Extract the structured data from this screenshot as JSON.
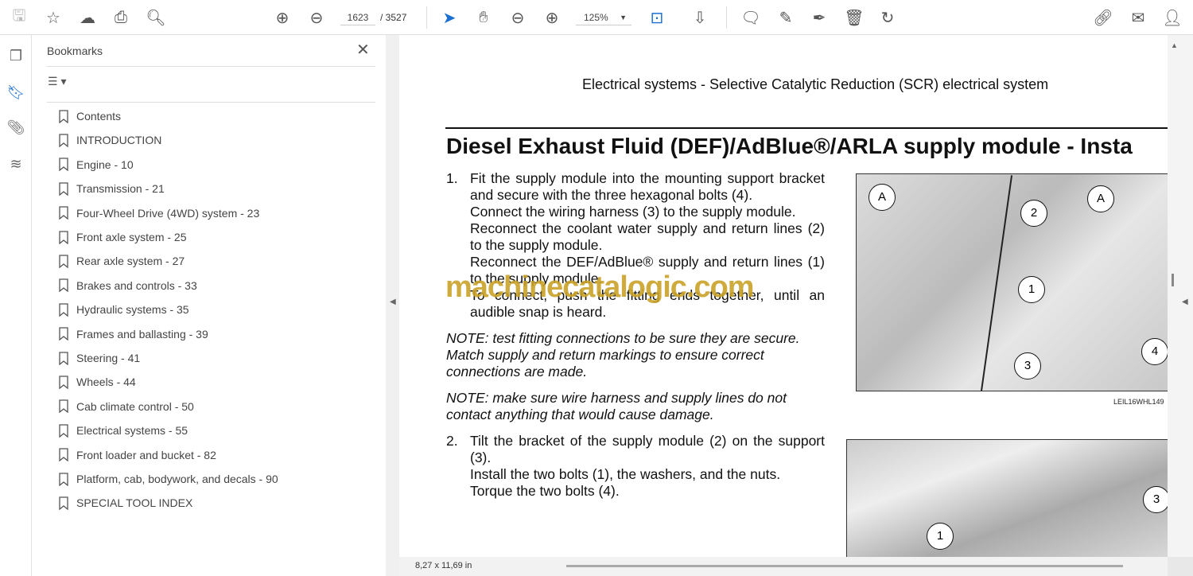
{
  "toolbar": {
    "page_current": "1623",
    "page_total": "/ 3527",
    "zoom": "125%",
    "icons": [
      "save-icon",
      "bookmark-star-icon",
      "upload-cloud-icon",
      "print-icon",
      "search-icon",
      "page-up-icon",
      "page-down-icon",
      "select-cursor-icon",
      "hand-icon",
      "zoom-out-icon",
      "zoom-in-icon",
      "fit-page-icon",
      "scroll-mode-icon",
      "comment-icon",
      "highlight-icon",
      "sign-icon",
      "delete-icon",
      "rotate-icon",
      "share-link-icon",
      "email-icon",
      "account-icon"
    ]
  },
  "sidebar": {
    "title": "Bookmarks",
    "items": [
      {
        "label": "Contents"
      },
      {
        "label": "INTRODUCTION"
      },
      {
        "label": "Engine - 10"
      },
      {
        "label": "Transmission - 21"
      },
      {
        "label": "Four-Wheel Drive (4WD) system - 23"
      },
      {
        "label": "Front axle system - 25"
      },
      {
        "label": "Rear axle system - 27"
      },
      {
        "label": "Brakes and controls - 33"
      },
      {
        "label": "Hydraulic systems - 35"
      },
      {
        "label": "Frames and ballasting - 39"
      },
      {
        "label": "Steering - 41"
      },
      {
        "label": "Wheels - 44"
      },
      {
        "label": "Cab climate control - 50"
      },
      {
        "label": "Electrical systems - 55"
      },
      {
        "label": "Front loader and bucket - 82"
      },
      {
        "label": "Platform, cab, bodywork, and decals - 90"
      },
      {
        "label": "SPECIAL TOOL INDEX"
      }
    ]
  },
  "document": {
    "header": "Electrical systems - Selective Catalytic Reduction (SCR) electrical system",
    "title": "Diesel Exhaust Fluid (DEF)/AdBlue®/ARLA supply module - Insta",
    "step1_num": "1.",
    "step1": [
      "Fit the supply module into the mounting support bracket and secure with the three hexagonal bolts (4).",
      "Connect the wiring harness (3) to the supply module.",
      "Reconnect the coolant water supply and return lines (2) to the supply module.",
      "Reconnect the DEF/AdBlue® supply and return lines (1) to the supply module.",
      "To connect, push the fitting ends together, until an audible snap is heard."
    ],
    "note1": "NOTE: test fitting connections to be sure they are secure. Match supply and return markings to ensure correct connections are made.",
    "note2": "NOTE: make sure wire harness and supply lines do not contact anything that would cause damage.",
    "step2_num": "2.",
    "step2": [
      "Tilt the bracket of the supply module (2) on the support (3).",
      "Install the two bolts (1), the washers, and the nuts.",
      "Torque the two bolts (4)."
    ],
    "figure1_caption": "LEIL16WHL149",
    "figure1_callouts": [
      "A",
      "A",
      "2",
      "1",
      "3",
      "4"
    ],
    "figure2_callouts": [
      "1",
      "3"
    ],
    "watermark": "machinecatalogic.com"
  },
  "status": {
    "page_size": "8,27 x 11,69 in"
  }
}
